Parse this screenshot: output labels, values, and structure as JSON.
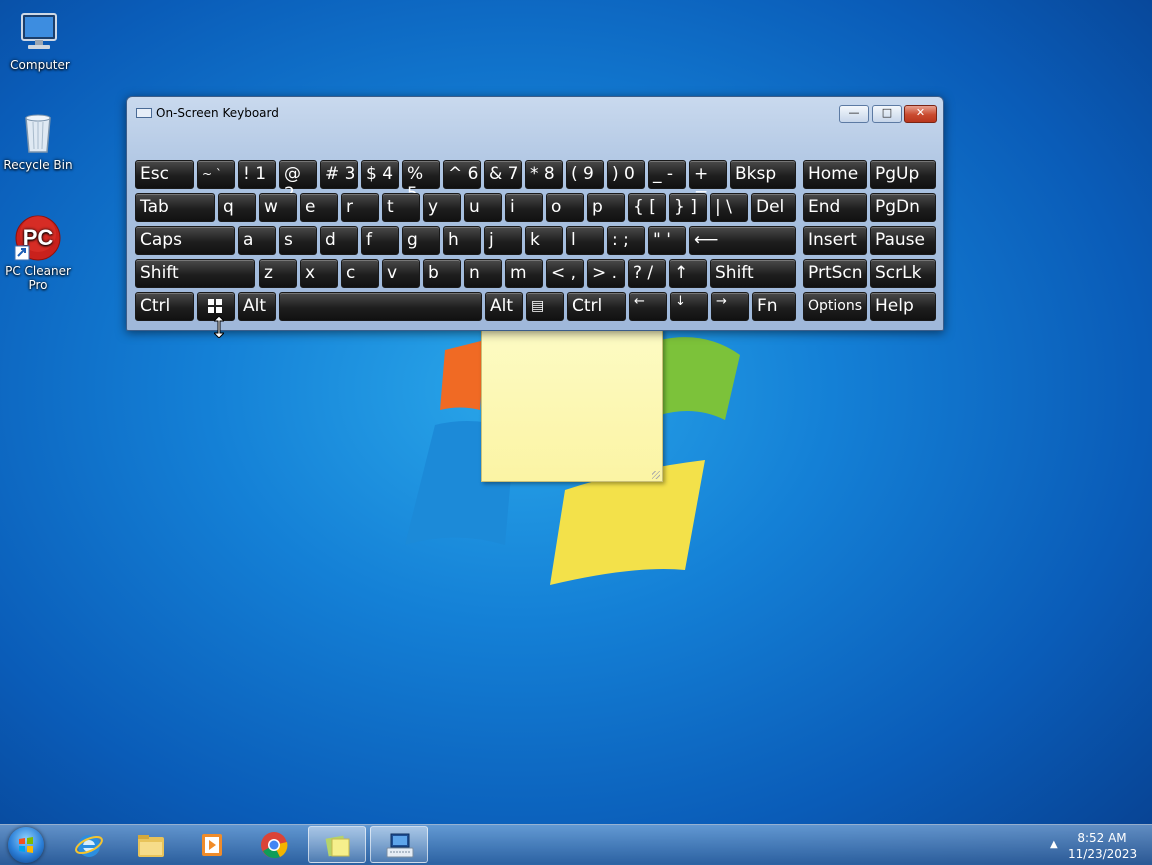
{
  "desktop": {
    "icons": [
      {
        "label": "Computer",
        "icon": "computer-icon"
      },
      {
        "label": "Recycle Bin",
        "icon": "recycle-bin-icon"
      },
      {
        "label": "PC Cleaner Pro",
        "icon": "pc-cleaner-icon",
        "badge_text": "PC"
      }
    ]
  },
  "osk": {
    "title": "On-Screen Keyboard",
    "controls": {
      "minimize": "—",
      "maximize": "□",
      "close": "✕"
    },
    "rows": [
      [
        "Esc",
        "~ `",
        "! 1",
        "@ 2",
        "# 3",
        "$ 4",
        "% 5",
        "^ 6",
        "& 7",
        "* 8",
        "( 9",
        ") 0",
        "_ -",
        "+ =",
        "Bksp",
        "Home",
        "PgUp"
      ],
      [
        "Tab",
        "q",
        "w",
        "e",
        "r",
        "t",
        "y",
        "u",
        "i",
        "o",
        "p",
        "{ [",
        "} ]",
        "| \\",
        "Del",
        "End",
        "PgDn"
      ],
      [
        "Caps",
        "a",
        "s",
        "d",
        "f",
        "g",
        "h",
        "j",
        "k",
        "l",
        ": ;",
        "\" '",
        "Enter",
        "Insert",
        "Pause"
      ],
      [
        "Shift",
        "z",
        "x",
        "c",
        "v",
        "b",
        "n",
        "m",
        "< ,",
        "> .",
        "? /",
        "↑",
        "Shift",
        "PrtScn",
        "ScrLk"
      ],
      [
        "Ctrl",
        "Win",
        "Alt",
        "Space",
        "Alt",
        "Menu",
        "Ctrl",
        "←",
        "↓",
        "→",
        "Fn",
        "Options",
        "Help"
      ]
    ]
  },
  "taskbar": {
    "pinned": [
      "internet-explorer-icon",
      "windows-explorer-icon",
      "media-player-icon",
      "chrome-icon",
      "sticky-notes-icon",
      "on-screen-keyboard-icon"
    ],
    "clock": {
      "time": "8:52 AM",
      "date": "11/23/2023"
    },
    "tray_arrow": "▲"
  }
}
